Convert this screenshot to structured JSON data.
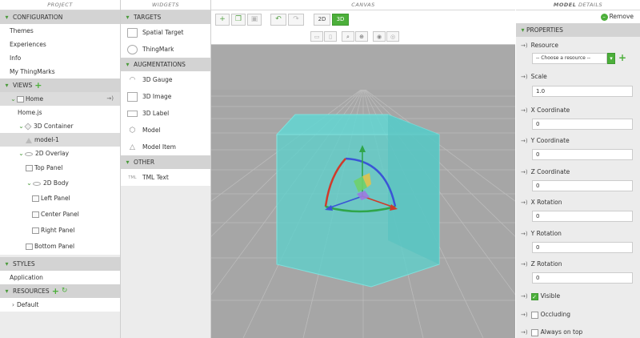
{
  "project": {
    "header": "Project",
    "configuration": {
      "label": "CONFIGURATION",
      "items": [
        "Themes",
        "Experiences",
        "Info",
        "My ThingMarks"
      ]
    },
    "views": {
      "label": "VIEWS",
      "home": "Home",
      "homejs": "Home.js",
      "container3d": "3D Container",
      "model": "model-1",
      "overlay": "2D Overlay",
      "toppanel": "Top Panel",
      "body2d": "2D Body",
      "left": "Left Panel",
      "center": "Center Panel",
      "right": "Right Panel",
      "bottom": "Bottom Panel",
      "nav_arrow": "→)"
    },
    "styles": {
      "label": "STYLES",
      "items": [
        "Application"
      ]
    },
    "resources": {
      "label": "RESOURCES",
      "items": [
        "Default"
      ]
    }
  },
  "widgets": {
    "header": "Widgets",
    "targets_label": "TARGETS",
    "targets": [
      "Spatial Target",
      "ThingMark"
    ],
    "augmentations_label": "AUGMENTATIONS",
    "augmentations": [
      "3D Gauge",
      "3D Image",
      "3D Label",
      "Model",
      "Model Item"
    ],
    "other_label": "OTHER",
    "other": [
      "TML Text"
    ],
    "tml_icon_text": "TML"
  },
  "canvas": {
    "header": "Canvas",
    "mode_2d": "2D",
    "mode_3d": "3D",
    "active_mode": "3D"
  },
  "details": {
    "header_a": "Model",
    "header_b": "Details",
    "remove_label": "Remove",
    "properties_label": "PROPERTIES",
    "resource_label": "Resource",
    "resource_value": "-- Choose a resource --",
    "scale_label": "Scale",
    "scale_value": "1.0",
    "x_coord_label": "X Coordinate",
    "x_coord_value": "0",
    "y_coord_label": "Y Coordinate",
    "y_coord_value": "0",
    "z_coord_label": "Z Coordinate",
    "z_coord_value": "0",
    "x_rot_label": "X Rotation",
    "x_rot_value": "0",
    "y_rot_label": "Y Rotation",
    "y_rot_value": "0",
    "z_rot_label": "Z Rotation",
    "z_rot_value": "0",
    "visible_label": "Visible",
    "visible": true,
    "occluding_label": "Occluding",
    "occluding": false,
    "ontop_label": "Always on top",
    "ontop": false,
    "bind_arrow": "→)"
  },
  "colors": {
    "accent": "#4caf3a",
    "cube_fill": "#5fd4d0",
    "floor": "#a6a6a6",
    "section": "#d3d3d3"
  }
}
